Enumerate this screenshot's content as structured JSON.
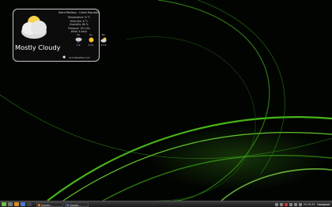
{
  "weather": {
    "location": "Dolní Břežany - Czech Republic",
    "condition": "Mostly Cloudy",
    "details": [
      "Temperature: 6 °C",
      "Feels like: 6 °C",
      "Humidity: 66 %",
      "Pressure: 102 kPa",
      "Wind: 4 km/h"
    ],
    "forecast": [
      {
        "day": "Sa",
        "temp": "7-9",
        "icon": "cloud-rain-icon"
      },
      {
        "day": "Su",
        "temp": "2-11",
        "icon": "sun-icon"
      },
      {
        "day": "Mo",
        "temp": "3-13",
        "icon": "partly-cloudy-icon"
      }
    ],
    "source": "AccuWeather.com"
  },
  "taskbar": {
    "task_label": "Google...",
    "task_label2": "Google...",
    "clock": "Fri 05:31",
    "user": "hosegood"
  },
  "colors": {
    "accent": "#5ad11e",
    "background": "#000000"
  }
}
